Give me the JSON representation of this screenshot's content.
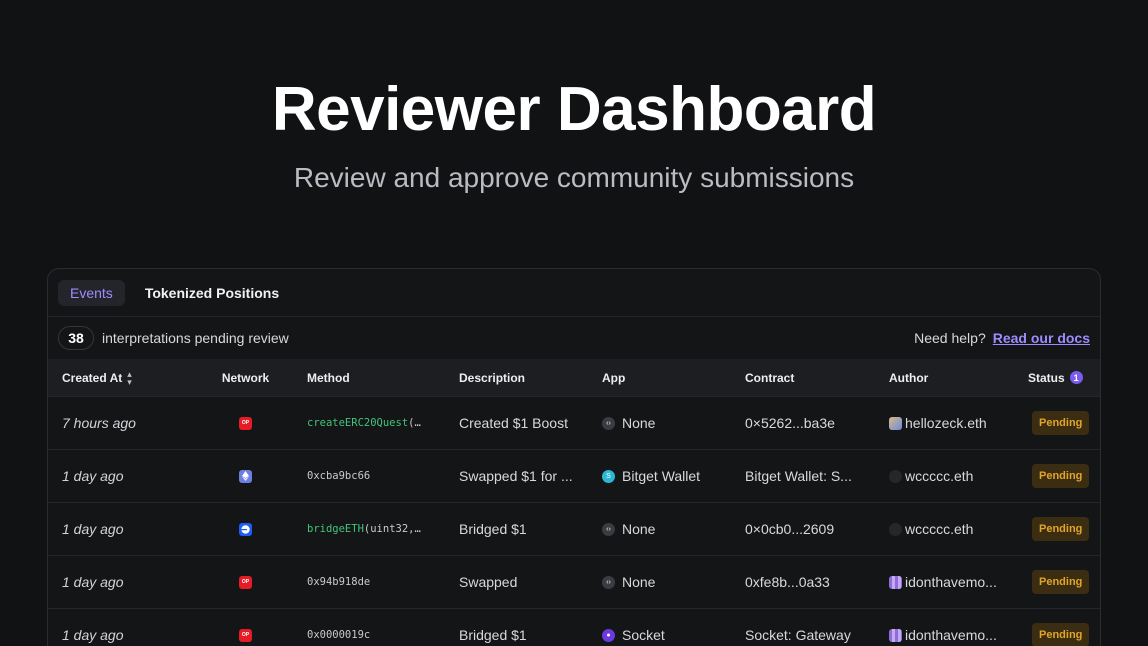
{
  "hero": {
    "title": "Reviewer Dashboard",
    "subtitle": "Review and approve community submissions"
  },
  "tabs": [
    {
      "label": "Events",
      "active": true
    },
    {
      "label": "Tokenized Positions",
      "active": false
    }
  ],
  "summary": {
    "count": "38",
    "text": "interpretations pending review",
    "help_text": "Need help?",
    "docs_link": "Read our docs"
  },
  "columns": {
    "created_at": "Created At",
    "network": "Network",
    "method": "Method",
    "description": "Description",
    "app": "App",
    "contract": "Contract",
    "author": "Author",
    "status": "Status",
    "status_count": "1"
  },
  "rows": [
    {
      "created": "7 hours ago",
      "network": "OP",
      "network_icon": "optimism-icon",
      "method_name": "createERC20Quest",
      "method_args": "(…",
      "description": "Created $1 Boost",
      "app": "None",
      "app_icon": "code-icon",
      "contract": "0×5262...ba3e",
      "author": "hellozeck.eth",
      "author_avatar": "image-avatar",
      "status": "Pending"
    },
    {
      "created": "1 day ago",
      "network": "",
      "network_icon": "ethereum-icon",
      "method_name": "",
      "method_args": "0xcba9bc66",
      "description": "Swapped $1 for ...",
      "app": "Bitget Wallet",
      "app_icon": "bitget-icon",
      "contract": "Bitget Wallet: S...",
      "author": "wccccc.eth",
      "author_avatar": "dark-avatar",
      "status": "Pending"
    },
    {
      "created": "1 day ago",
      "network": "",
      "network_icon": "base-icon",
      "method_name": "bridgeETH",
      "method_args": "(uint32,…",
      "description": "Bridged $1",
      "app": "None",
      "app_icon": "code-icon",
      "contract": "0×0cb0...2609",
      "author": "wccccc.eth",
      "author_avatar": "dark-avatar",
      "status": "Pending"
    },
    {
      "created": "1 day ago",
      "network": "OP",
      "network_icon": "optimism-icon",
      "method_name": "",
      "method_args": "0x94b918de",
      "description": "Swapped",
      "app": "None",
      "app_icon": "code-icon",
      "contract": "0xfe8b...0a33",
      "author": "idonthavemo...",
      "author_avatar": "pixel-avatar",
      "status": "Pending"
    },
    {
      "created": "1 day ago",
      "network": "OP",
      "network_icon": "optimism-icon",
      "method_name": "",
      "method_args": "0x0000019c",
      "description": "Bridged $1",
      "app": "Socket",
      "app_icon": "socket-icon",
      "contract": "Socket: Gateway",
      "author": "idonthavemo...",
      "author_avatar": "pixel-avatar",
      "status": "Pending"
    }
  ],
  "colors": {
    "accent": "#9d8cff",
    "pending_bg": "#3a2d12",
    "pending_text": "#e2a42b",
    "method_green": "#44c47a"
  }
}
